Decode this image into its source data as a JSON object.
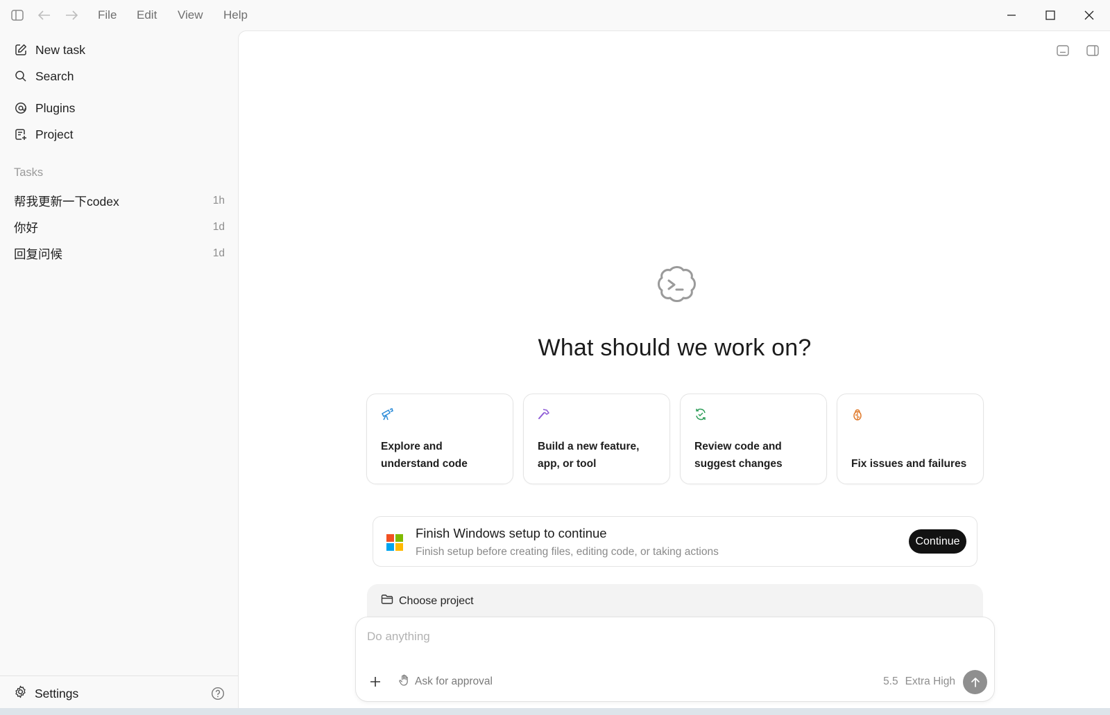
{
  "menu": [
    "File",
    "Edit",
    "View",
    "Help"
  ],
  "sidebar": {
    "nav": {
      "new_task": "New task",
      "search": "Search",
      "plugins": "Plugins",
      "project": "Project"
    },
    "tasks_label": "Tasks",
    "tasks": [
      {
        "title": "帮我更新一下codex",
        "age": "1h"
      },
      {
        "title": "你好",
        "age": "1d"
      },
      {
        "title": "回复问候",
        "age": "1d"
      }
    ],
    "settings": "Settings"
  },
  "main": {
    "headline": "What should we work on?",
    "cards": [
      {
        "icon": "telescope-icon",
        "line1": "Explore and",
        "line2": "understand code",
        "color": "#2a8bd8"
      },
      {
        "icon": "hammer-icon",
        "line1": "Build a new feature,",
        "line2": "app, or tool",
        "color": "#8e5bd6"
      },
      {
        "icon": "review-icon",
        "line1": "Review code and",
        "line2": "suggest changes",
        "color": "#2f9e5a"
      },
      {
        "icon": "bug-icon",
        "line1": "",
        "line2": "Fix issues and failures",
        "color": "#e07a2b"
      }
    ],
    "setup": {
      "title": "Finish Windows setup to continue",
      "subtitle": "Finish setup before creating files, editing code, or taking actions",
      "button": "Continue"
    },
    "project_chip": "Choose project",
    "composer": {
      "placeholder": "Do anything",
      "approval": "Ask for approval",
      "model_version": "5.5",
      "model_effort": "Extra High"
    }
  },
  "colors": {
    "win_red": "#f25022",
    "win_green": "#7fba00",
    "win_blue": "#00a4ef",
    "win_yellow": "#ffb900"
  }
}
